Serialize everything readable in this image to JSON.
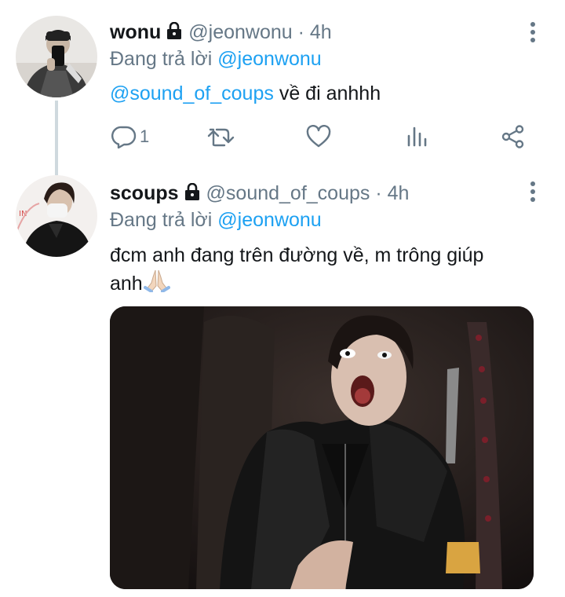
{
  "tweets": [
    {
      "name": "wonu",
      "handle": "@jeonwonu",
      "time": "4h",
      "handle_line": "@jeonwonu · 4h",
      "replying_prefix": "Đang trả lời",
      "replying_to": "@jeonwonu",
      "text_mention": "@sound_of_coups",
      "text": " về đi anhhh",
      "actions": {
        "reply_count": "1"
      }
    },
    {
      "name": "scoups",
      "handle": "@sound_of_coups",
      "time": "4h",
      "handle_line": "@sound_of_coups · 4h",
      "replying_prefix": "Đang trả lời",
      "replying_to": "@jeonwonu",
      "text_line1": "đcm anh đang trên đường về, m trông giúp",
      "text_line2": "anh",
      "emoji": "folded-hands-emoji"
    }
  ],
  "icons": [
    "lock-icon",
    "more-icon",
    "reply-icon",
    "retweet-icon",
    "like-icon",
    "analytics-icon",
    "share-icon"
  ],
  "colors": {
    "link": "#1da1f2",
    "muted": "#657786",
    "text": "#14171a",
    "thread_line": "#cfd9de"
  }
}
